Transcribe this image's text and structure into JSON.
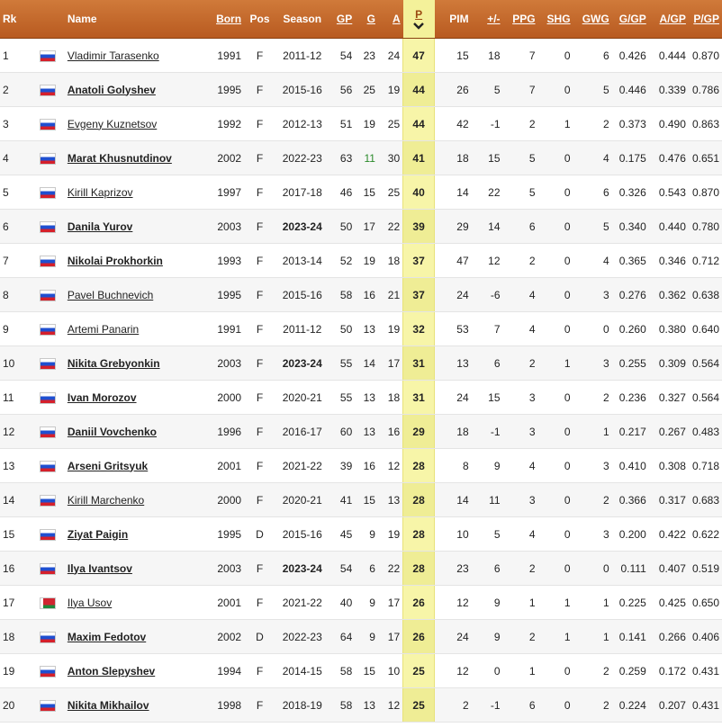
{
  "headers": {
    "rk": "Rk",
    "name": "Name",
    "born": "Born",
    "pos": "Pos",
    "season": "Season",
    "gp": "GP",
    "g": "G",
    "a": "A",
    "p": "P",
    "pim": "PIM",
    "pm": "+/-",
    "ppg": "PPG",
    "shg": "SHG",
    "gwg": "GWG",
    "ggp": "G/GP",
    "agp": "A/GP",
    "pgp": "P/GP"
  },
  "colors": {
    "header_bg": "#c4672a",
    "header_text": "#ffffff",
    "sorted_bg": "#f4f19a",
    "sorted_arrow": "#9b4a12",
    "highlight_g": "#2a8a2a"
  },
  "sort": {
    "column": "p",
    "direction": "desc",
    "icon": "sort-desc-chevron-icon"
  },
  "rows": [
    {
      "rk": "1",
      "flag": "ru",
      "name": "Vladimir Tarasenko",
      "bold": false,
      "born": "1991",
      "pos": "F",
      "season": "2011-12",
      "season_bold": false,
      "gp": "54",
      "g": "23",
      "a": "24",
      "p": "47",
      "pim": "15",
      "pm": "18",
      "ppg": "7",
      "shg": "0",
      "gwg": "6",
      "ggp": "0.426",
      "agp": "0.444",
      "pgp": "0.870"
    },
    {
      "rk": "2",
      "flag": "ru",
      "name": "Anatoli Golyshev",
      "bold": true,
      "born": "1995",
      "pos": "F",
      "season": "2015-16",
      "season_bold": false,
      "gp": "56",
      "g": "25",
      "a": "19",
      "p": "44",
      "pim": "26",
      "pm": "5",
      "ppg": "7",
      "shg": "0",
      "gwg": "5",
      "ggp": "0.446",
      "agp": "0.339",
      "pgp": "0.786"
    },
    {
      "rk": "3",
      "flag": "ru",
      "name": "Evgeny Kuznetsov",
      "bold": false,
      "born": "1992",
      "pos": "F",
      "season": "2012-13",
      "season_bold": false,
      "gp": "51",
      "g": "19",
      "a": "25",
      "p": "44",
      "pim": "42",
      "pm": "-1",
      "ppg": "2",
      "shg": "1",
      "gwg": "2",
      "ggp": "0.373",
      "agp": "0.490",
      "pgp": "0.863"
    },
    {
      "rk": "4",
      "flag": "ru",
      "name": "Marat Khusnutdinov",
      "bold": true,
      "born": "2002",
      "pos": "F",
      "season": "2022-23",
      "season_bold": false,
      "gp": "63",
      "g": "11",
      "g_green": true,
      "a": "30",
      "p": "41",
      "pim": "18",
      "pm": "15",
      "ppg": "5",
      "shg": "0",
      "gwg": "4",
      "ggp": "0.175",
      "agp": "0.476",
      "pgp": "0.651"
    },
    {
      "rk": "5",
      "flag": "ru",
      "name": "Kirill Kaprizov",
      "bold": false,
      "born": "1997",
      "pos": "F",
      "season": "2017-18",
      "season_bold": false,
      "gp": "46",
      "g": "15",
      "a": "25",
      "p": "40",
      "pim": "14",
      "pm": "22",
      "ppg": "5",
      "shg": "0",
      "gwg": "6",
      "ggp": "0.326",
      "agp": "0.543",
      "pgp": "0.870"
    },
    {
      "rk": "6",
      "flag": "ru",
      "name": "Danila Yurov",
      "bold": true,
      "born": "2003",
      "pos": "F",
      "season": "2023-24",
      "season_bold": true,
      "gp": "50",
      "g": "17",
      "a": "22",
      "p": "39",
      "pim": "29",
      "pm": "14",
      "ppg": "6",
      "shg": "0",
      "gwg": "5",
      "ggp": "0.340",
      "agp": "0.440",
      "pgp": "0.780"
    },
    {
      "rk": "7",
      "flag": "ru",
      "name": "Nikolai Prokhorkin",
      "bold": true,
      "born": "1993",
      "pos": "F",
      "season": "2013-14",
      "season_bold": false,
      "gp": "52",
      "g": "19",
      "a": "18",
      "p": "37",
      "pim": "47",
      "pm": "12",
      "ppg": "2",
      "shg": "0",
      "gwg": "4",
      "ggp": "0.365",
      "agp": "0.346",
      "pgp": "0.712"
    },
    {
      "rk": "8",
      "flag": "ru",
      "name": "Pavel Buchnevich",
      "bold": false,
      "born": "1995",
      "pos": "F",
      "season": "2015-16",
      "season_bold": false,
      "gp": "58",
      "g": "16",
      "a": "21",
      "p": "37",
      "pim": "24",
      "pm": "-6",
      "ppg": "4",
      "shg": "0",
      "gwg": "3",
      "ggp": "0.276",
      "agp": "0.362",
      "pgp": "0.638"
    },
    {
      "rk": "9",
      "flag": "ru",
      "name": "Artemi Panarin",
      "bold": false,
      "born": "1991",
      "pos": "F",
      "season": "2011-12",
      "season_bold": false,
      "gp": "50",
      "g": "13",
      "a": "19",
      "p": "32",
      "pim": "53",
      "pm": "7",
      "ppg": "4",
      "shg": "0",
      "gwg": "0",
      "ggp": "0.260",
      "agp": "0.380",
      "pgp": "0.640"
    },
    {
      "rk": "10",
      "flag": "ru",
      "name": "Nikita Grebyonkin",
      "bold": true,
      "born": "2003",
      "pos": "F",
      "season": "2023-24",
      "season_bold": true,
      "gp": "55",
      "g": "14",
      "a": "17",
      "p": "31",
      "pim": "13",
      "pm": "6",
      "ppg": "2",
      "shg": "1",
      "gwg": "3",
      "ggp": "0.255",
      "agp": "0.309",
      "pgp": "0.564"
    },
    {
      "rk": "11",
      "flag": "ru",
      "name": "Ivan Morozov",
      "bold": true,
      "born": "2000",
      "pos": "F",
      "season": "2020-21",
      "season_bold": false,
      "gp": "55",
      "g": "13",
      "a": "18",
      "p": "31",
      "pim": "24",
      "pm": "15",
      "ppg": "3",
      "shg": "0",
      "gwg": "2",
      "ggp": "0.236",
      "agp": "0.327",
      "pgp": "0.564"
    },
    {
      "rk": "12",
      "flag": "ru",
      "name": "Daniil Vovchenko",
      "bold": true,
      "born": "1996",
      "pos": "F",
      "season": "2016-17",
      "season_bold": false,
      "gp": "60",
      "g": "13",
      "a": "16",
      "p": "29",
      "pim": "18",
      "pm": "-1",
      "ppg": "3",
      "shg": "0",
      "gwg": "1",
      "ggp": "0.217",
      "agp": "0.267",
      "pgp": "0.483"
    },
    {
      "rk": "13",
      "flag": "ru",
      "name": "Arseni Gritsyuk",
      "bold": true,
      "born": "2001",
      "pos": "F",
      "season": "2021-22",
      "season_bold": false,
      "gp": "39",
      "g": "16",
      "a": "12",
      "p": "28",
      "pim": "8",
      "pm": "9",
      "ppg": "4",
      "shg": "0",
      "gwg": "3",
      "ggp": "0.410",
      "agp": "0.308",
      "pgp": "0.718"
    },
    {
      "rk": "14",
      "flag": "ru",
      "name": "Kirill Marchenko",
      "bold": false,
      "born": "2000",
      "pos": "F",
      "season": "2020-21",
      "season_bold": false,
      "gp": "41",
      "g": "15",
      "a": "13",
      "p": "28",
      "pim": "14",
      "pm": "11",
      "ppg": "3",
      "shg": "0",
      "gwg": "2",
      "ggp": "0.366",
      "agp": "0.317",
      "pgp": "0.683"
    },
    {
      "rk": "15",
      "flag": "ru",
      "name": "Ziyat Paigin",
      "bold": true,
      "born": "1995",
      "pos": "D",
      "season": "2015-16",
      "season_bold": false,
      "gp": "45",
      "g": "9",
      "a": "19",
      "p": "28",
      "pim": "10",
      "pm": "5",
      "ppg": "4",
      "shg": "0",
      "gwg": "3",
      "ggp": "0.200",
      "agp": "0.422",
      "pgp": "0.622"
    },
    {
      "rk": "16",
      "flag": "ru",
      "name": "Ilya Ivantsov",
      "bold": true,
      "born": "2003",
      "pos": "F",
      "season": "2023-24",
      "season_bold": true,
      "gp": "54",
      "g": "6",
      "a": "22",
      "p": "28",
      "pim": "23",
      "pm": "6",
      "ppg": "2",
      "shg": "0",
      "gwg": "0",
      "ggp": "0.111",
      "agp": "0.407",
      "pgp": "0.519"
    },
    {
      "rk": "17",
      "flag": "by",
      "name": "Ilya Usov",
      "bold": false,
      "born": "2001",
      "pos": "F",
      "season": "2021-22",
      "season_bold": false,
      "gp": "40",
      "g": "9",
      "a": "17",
      "p": "26",
      "pim": "12",
      "pm": "9",
      "ppg": "1",
      "shg": "1",
      "gwg": "1",
      "ggp": "0.225",
      "agp": "0.425",
      "pgp": "0.650"
    },
    {
      "rk": "18",
      "flag": "ru",
      "name": "Maxim Fedotov",
      "bold": true,
      "born": "2002",
      "pos": "D",
      "season": "2022-23",
      "season_bold": false,
      "gp": "64",
      "g": "9",
      "a": "17",
      "p": "26",
      "pim": "24",
      "pm": "9",
      "ppg": "2",
      "shg": "1",
      "gwg": "1",
      "ggp": "0.141",
      "agp": "0.266",
      "pgp": "0.406"
    },
    {
      "rk": "19",
      "flag": "ru",
      "name": "Anton Slepyshev",
      "bold": true,
      "born": "1994",
      "pos": "F",
      "season": "2014-15",
      "season_bold": false,
      "gp": "58",
      "g": "15",
      "a": "10",
      "p": "25",
      "pim": "12",
      "pm": "0",
      "ppg": "1",
      "shg": "0",
      "gwg": "2",
      "ggp": "0.259",
      "agp": "0.172",
      "pgp": "0.431"
    },
    {
      "rk": "20",
      "flag": "ru",
      "name": "Nikita Mikhailov",
      "bold": true,
      "born": "1998",
      "pos": "F",
      "season": "2018-19",
      "season_bold": false,
      "gp": "58",
      "g": "13",
      "a": "12",
      "p": "25",
      "pim": "2",
      "pm": "-1",
      "ppg": "6",
      "shg": "0",
      "gwg": "2",
      "ggp": "0.224",
      "agp": "0.207",
      "pgp": "0.431"
    }
  ]
}
